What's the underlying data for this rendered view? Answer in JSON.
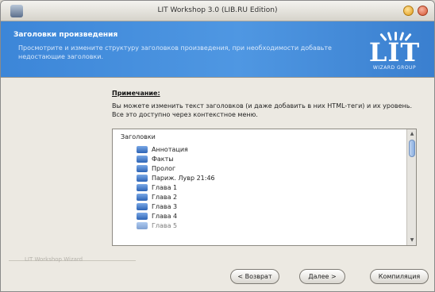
{
  "window": {
    "title": "LIT Workshop 3.0 (LIB.RU Edition)"
  },
  "header": {
    "title": "Заголовки произведения",
    "subtitle": "Просмотрите и измените структуру заголовков произведения, при необходимости добавьте недостающие заголовки."
  },
  "logo": {
    "text": "LIT",
    "subtext": "WIZARD GROUP"
  },
  "note": {
    "title": "Примечание:",
    "text": "Вы можете изменить текст заголовков (и даже добавить в них HTML-теги) и их уровень. Все это доступно через контекстное меню."
  },
  "tree": {
    "root": "Заголовки",
    "items": [
      {
        "label": "Аннотация"
      },
      {
        "label": "Факты"
      },
      {
        "label": "Пролог"
      },
      {
        "label": "Париж. Лувр 21:46"
      },
      {
        "label": "Глава 1"
      },
      {
        "label": "Глава 2"
      },
      {
        "label": "Глава 3"
      },
      {
        "label": "Глава 4"
      },
      {
        "label": "Глава 5"
      }
    ]
  },
  "footer": {
    "text": "LIT Workshop Wizard"
  },
  "buttons": {
    "back": "< Возврат",
    "next": "Далее >",
    "compile": "Компиляция"
  },
  "colors": {
    "header_blue": "#3c86d8",
    "window_bg": "#ece9e2"
  }
}
